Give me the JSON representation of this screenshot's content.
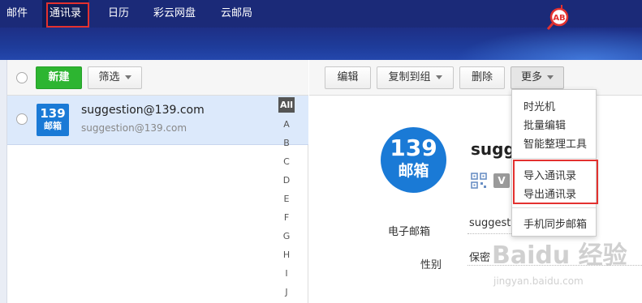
{
  "nav": {
    "items": [
      "邮件",
      "通讯录",
      "日历",
      "彩云网盘",
      "云邮局"
    ],
    "active_index": 1
  },
  "toolbar_left": {
    "new_label": "新建",
    "filter_label": "筛选"
  },
  "contact_list": [
    {
      "avatar_number": "139",
      "avatar_chars": "邮箱",
      "name": "suggestion@139.com",
      "email": "suggestion@139.com"
    }
  ],
  "alphabet": [
    "All",
    "A",
    "B",
    "C",
    "D",
    "E",
    "F",
    "G",
    "H",
    "I",
    "J"
  ],
  "toolbar_right": {
    "edit_label": "编辑",
    "copy_to_group_label": "复制到组",
    "delete_label": "删除",
    "more_label": "更多"
  },
  "more_menu": {
    "items": [
      "时光机",
      "批量编辑",
      "智能整理工具",
      "导入通讯录",
      "导出通讯录",
      "手机同步邮箱"
    ]
  },
  "detail": {
    "avatar_number": "139",
    "avatar_chars": "邮箱",
    "name_visible": "suggestion",
    "v_badge": "V",
    "email_label": "电子邮箱",
    "email_value": "suggestion",
    "gender_label": "性别",
    "gender_value": "保密"
  },
  "watermark": {
    "logo_text": "Baidu 经验",
    "url": "jingyan.baidu.com"
  },
  "magnifier_badge": "AB",
  "colors": {
    "nav_bg": "#1b2a78",
    "primary_green": "#2db531",
    "brand_blue": "#1a7ad6",
    "highlight_red": "#e3312f",
    "selected_row": "#dce9fb"
  }
}
